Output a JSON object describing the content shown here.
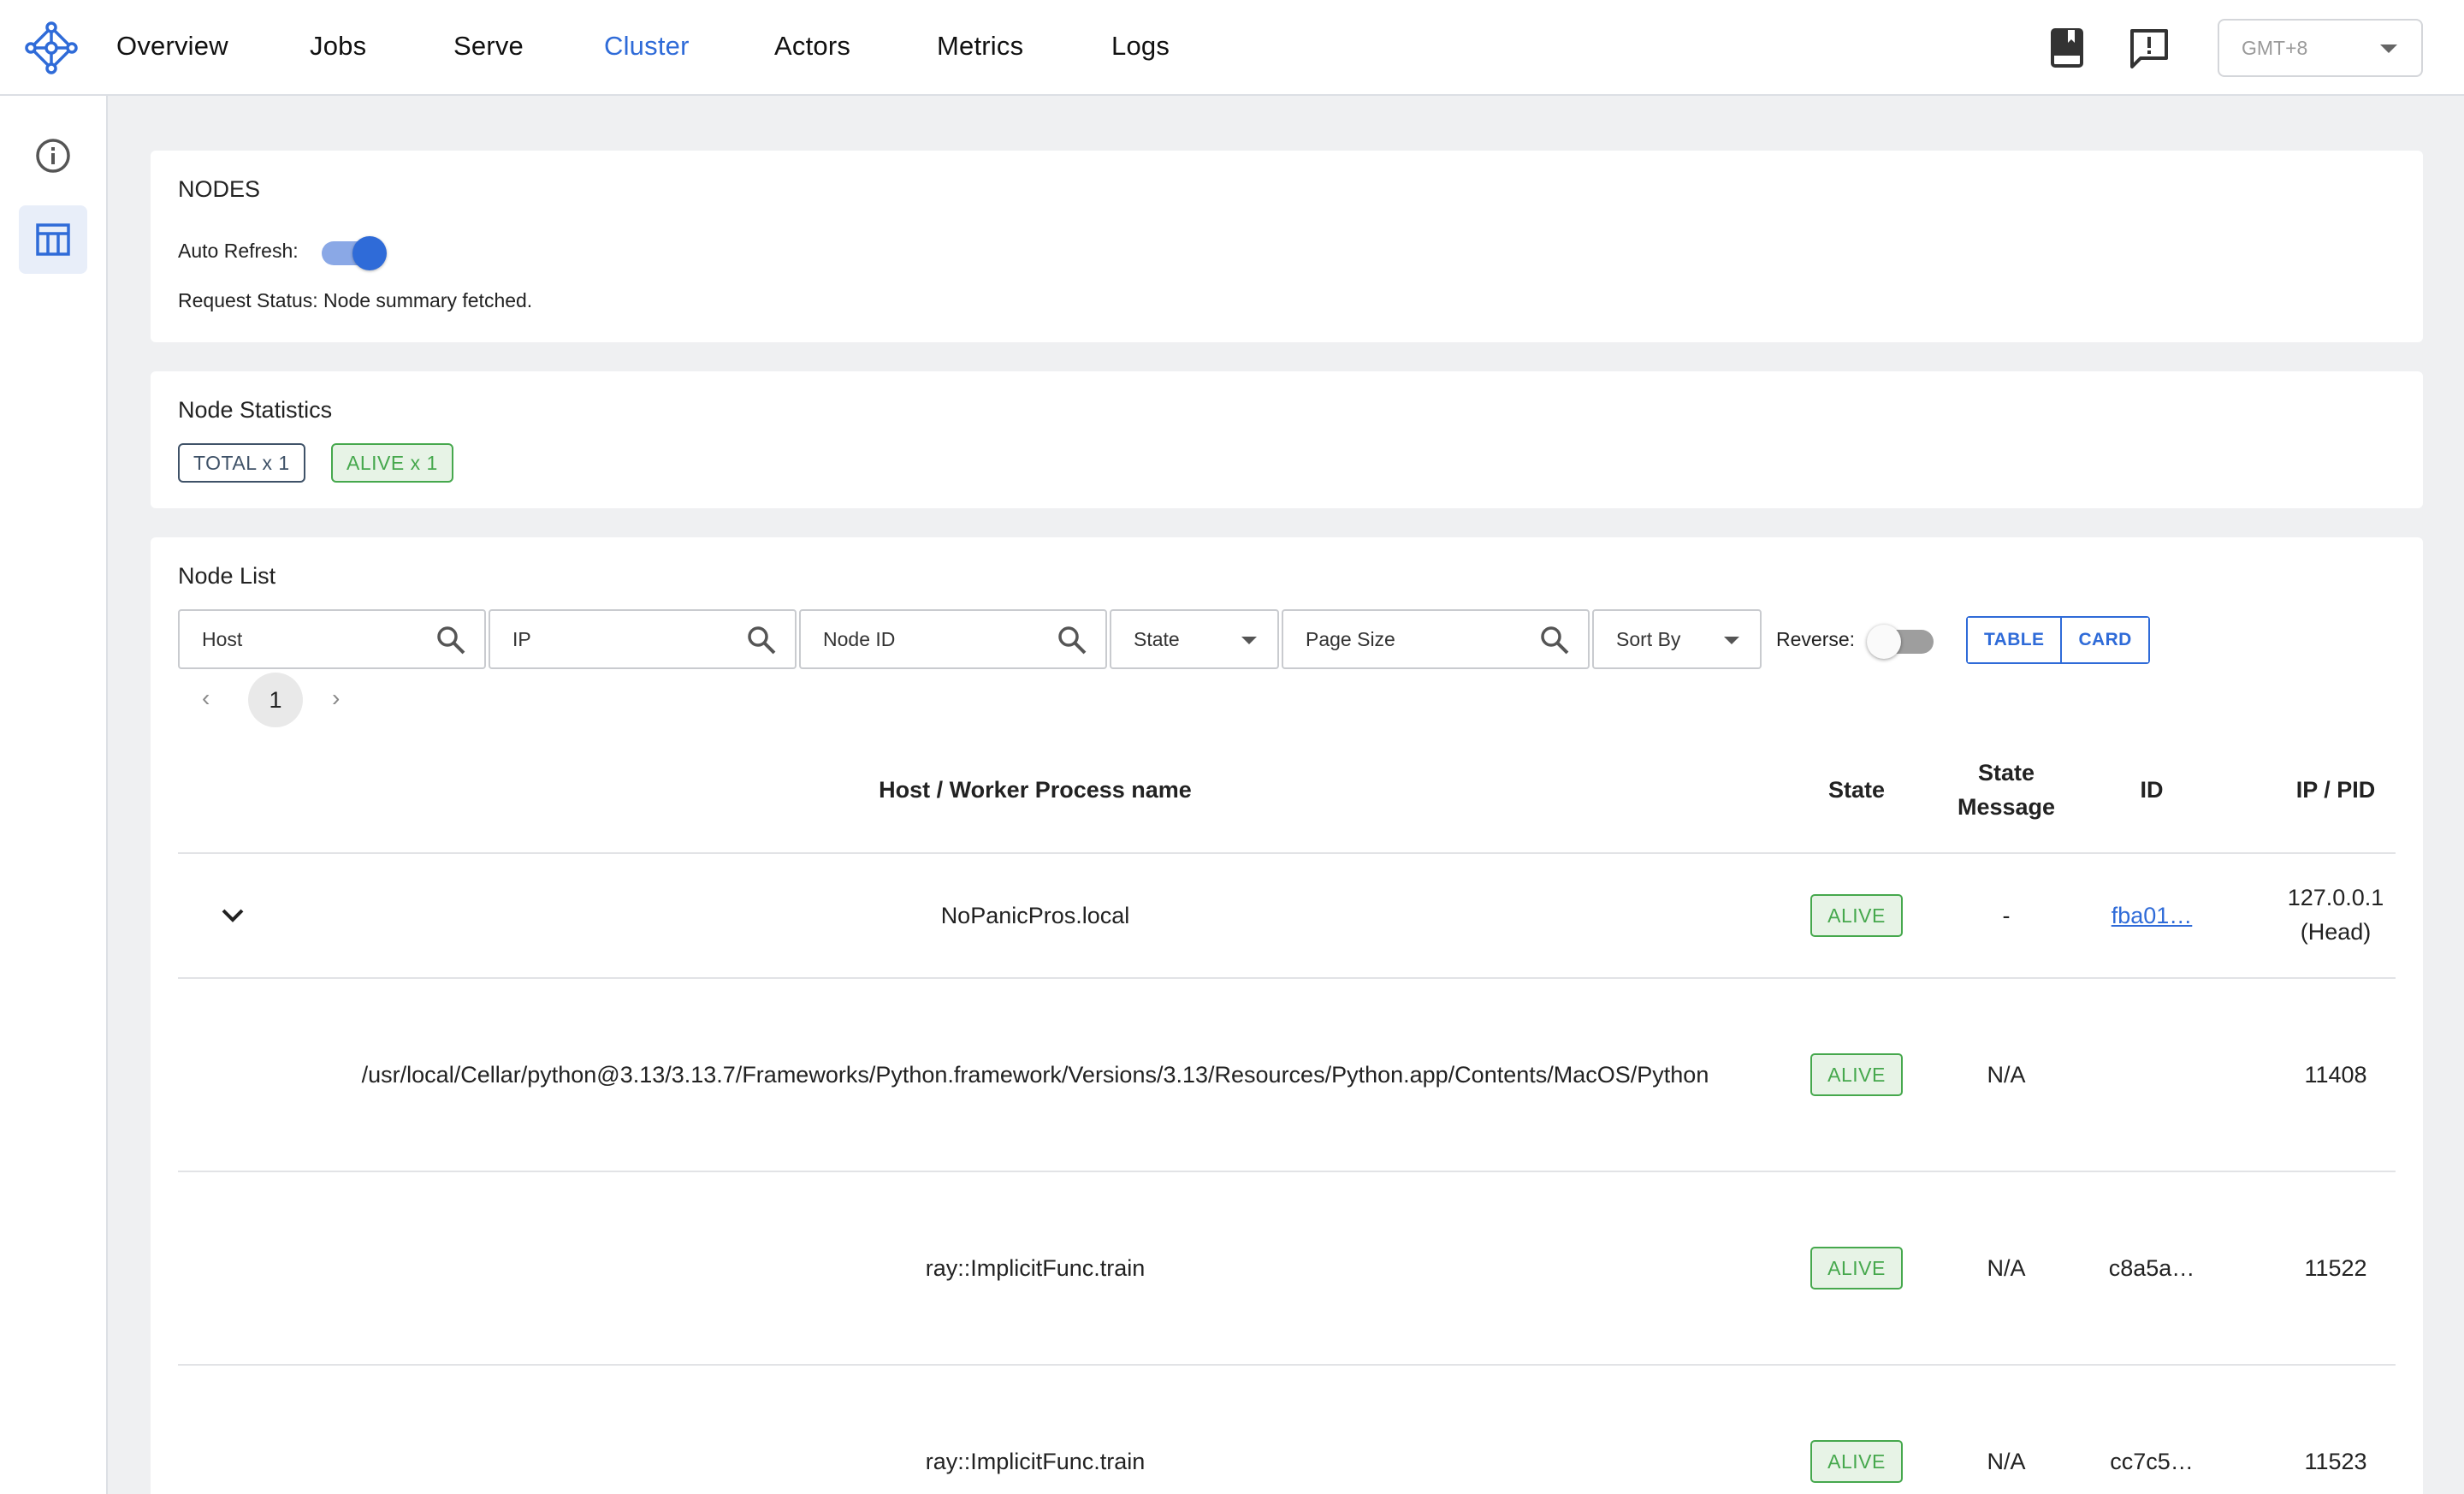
{
  "nav": {
    "items": [
      {
        "label": "Overview"
      },
      {
        "label": "Jobs"
      },
      {
        "label": "Serve"
      },
      {
        "label": "Cluster"
      },
      {
        "label": "Actors"
      },
      {
        "label": "Metrics"
      },
      {
        "label": "Logs"
      }
    ],
    "active": "Cluster",
    "timezone": "GMT+8",
    "icons": [
      "book-icon",
      "feedback-icon"
    ]
  },
  "sidebar": {
    "items": [
      {
        "icon": "info-icon"
      },
      {
        "icon": "table-icon",
        "active": true
      }
    ]
  },
  "nodes": {
    "title": "NODES",
    "auto_refresh_label": "Auto Refresh:",
    "auto_refresh_on": true,
    "request_status": "Request Status: Node summary fetched."
  },
  "stats": {
    "title": "Node Statistics",
    "total": "TOTAL x 1",
    "alive": "ALIVE x 1"
  },
  "node_list": {
    "title": "Node List",
    "filters": {
      "host": "Host",
      "ip": "IP",
      "node_id": "Node ID",
      "state": "State",
      "page_size": "Page Size",
      "sort_by": "Sort By"
    },
    "reverse_label": "Reverse:",
    "reverse_on": false,
    "view_table": "TABLE",
    "view_card": "CARD",
    "page": "1",
    "columns": {
      "host": "Host / Worker Process name",
      "state": "State",
      "state_message_1": "State",
      "state_message_2": "Message",
      "id": "ID",
      "ip_pid": "IP / PID"
    },
    "rows": [
      {
        "name": "NoPanicPros.local",
        "state": "ALIVE",
        "message": "-",
        "id": "fba01…",
        "ip_1": "127.0.0.1",
        "ip_2": "(Head)"
      },
      {
        "name": "/usr/local/Cellar/python@3.13/3.13.7/Frameworks/Python.framework/Versions/3.13/Resources/Python.app/Contents/MacOS/Python",
        "state": "ALIVE",
        "message": "N/A",
        "id": "",
        "pid": "11408"
      },
      {
        "name": "ray::ImplicitFunc.train",
        "state": "ALIVE",
        "message": "N/A",
        "id": "c8a5a…",
        "pid": "11522"
      },
      {
        "name": "ray::ImplicitFunc.train",
        "state": "ALIVE",
        "message": "N/A",
        "id": "cc7c5…",
        "pid": "11523"
      }
    ]
  },
  "colors": {
    "accent": "#2f6bd8",
    "alive": "#46a84d",
    "background": "#eff0f2"
  }
}
